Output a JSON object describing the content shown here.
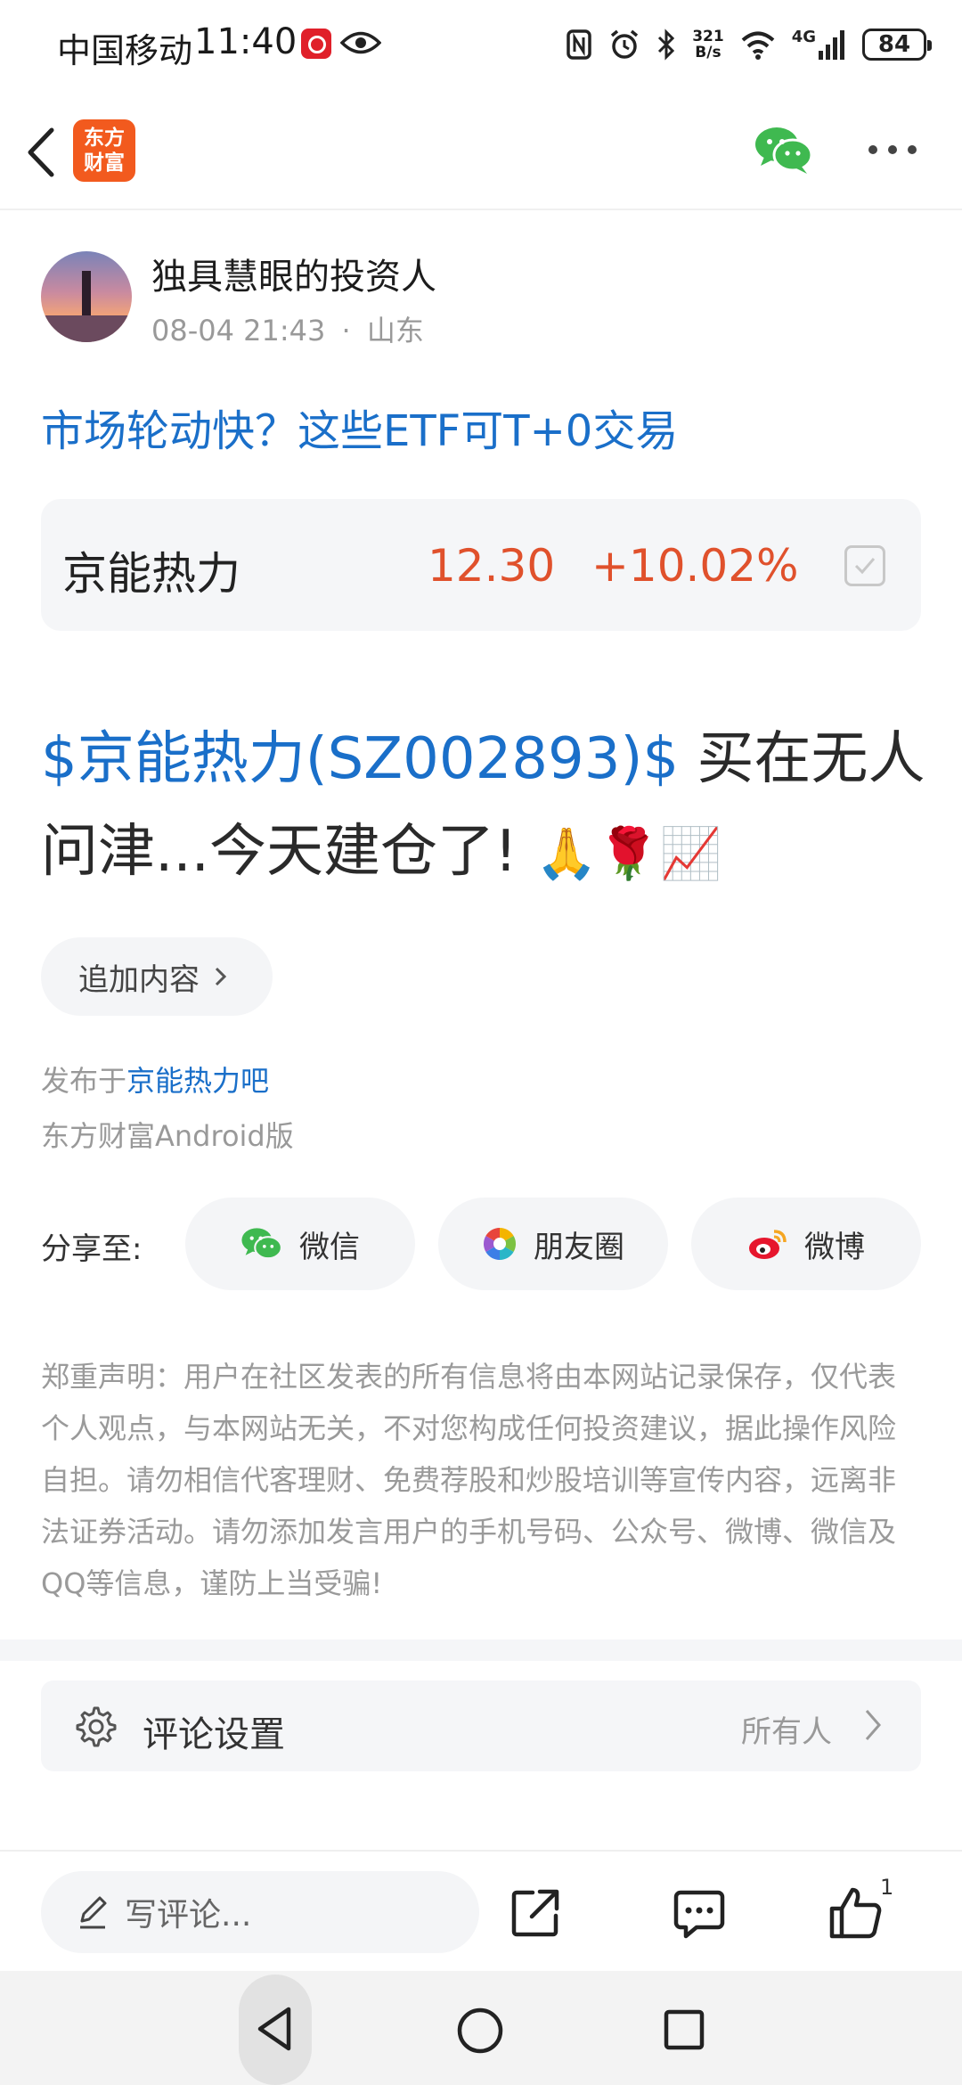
{
  "status_bar": {
    "carrier": "中国移动",
    "time": "11:40",
    "net_speed_value": "321",
    "net_speed_unit": "B/s",
    "network_type": "4G",
    "battery": "84"
  },
  "header": {
    "logo_line1": "东方",
    "logo_line2": "财富"
  },
  "author": {
    "name": "独具慧眼的投资人",
    "datetime": "08-04 21:43",
    "separator": "·",
    "location": "山东"
  },
  "post": {
    "title": "市场轮动快？这些ETF可T+0交易",
    "stock_tag": "$京能热力(SZ002893)$",
    "body_text": " 买在无人问津...今天建仓了! ",
    "emojis": "🙏🌹📈"
  },
  "stock_card": {
    "name": "京能热力",
    "price": "12.30",
    "change": "+10.02%",
    "price_color": "#e0512c"
  },
  "add_content": {
    "label": "追加内容"
  },
  "meta": {
    "published_prefix": "发布于",
    "published_forum": "京能热力吧",
    "client": "东方财富Android版"
  },
  "share": {
    "label": "分享至:",
    "targets": [
      {
        "label": "微信",
        "icon": "wechat-icon"
      },
      {
        "label": "朋友圈",
        "icon": "moments-icon"
      },
      {
        "label": "微博",
        "icon": "weibo-icon"
      }
    ]
  },
  "disclaimer": "郑重声明：用户在社区发表的所有信息将由本网站记录保存，仅代表个人观点，与本网站无关，不对您构成任何投资建议，据此操作风险自担。请勿相信代客理财、免费荐股和炒股培训等宣传内容，远离非法证券活动。请勿添加发言用户的手机号码、公众号、微博、微信及QQ等信息，谨防上当受骗!",
  "comment_settings": {
    "label": "评论设置",
    "value": "所有人"
  },
  "bottom_bar": {
    "comment_placeholder": "写评论...",
    "like_count": "1"
  },
  "colors": {
    "link_blue": "#1a6fc9",
    "rise_red": "#e0512c",
    "brand_orange": "#f25a1e",
    "wechat_green": "#3fb950"
  }
}
